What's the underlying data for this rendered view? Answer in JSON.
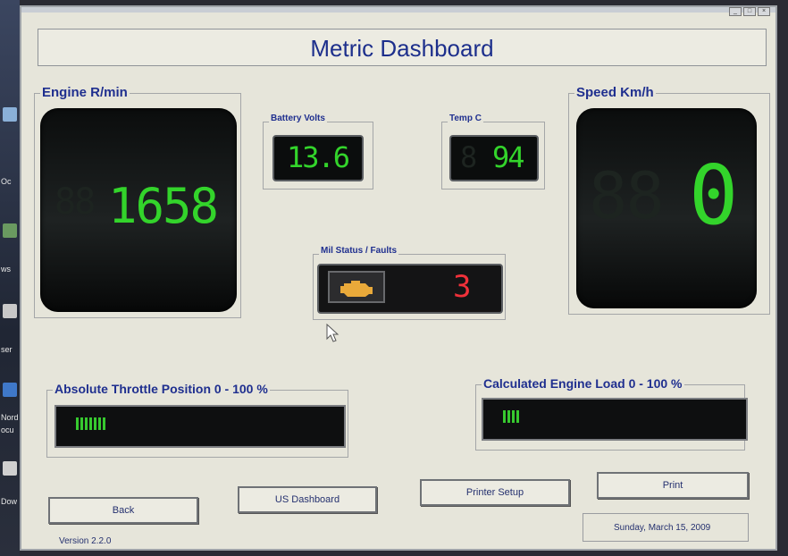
{
  "window": {
    "title": "Metric Dashboard",
    "version": "Version 2.2.0",
    "date": "Sunday, March 15, 2009"
  },
  "engine": {
    "label": "Engine R/min",
    "ghost": "88",
    "value": "1658"
  },
  "speed": {
    "label": "Speed Km/h",
    "ghost": "88",
    "value": "0"
  },
  "battery": {
    "label": "Battery Volts",
    "value": "13.6"
  },
  "temp": {
    "label": "Temp C",
    "ghost": "8",
    "value": "94"
  },
  "mil": {
    "label": "Mil Status / Faults",
    "faults": "3"
  },
  "throttle": {
    "label": "Absolute Throttle Position 0 - 100 %",
    "percent": 12
  },
  "load": {
    "label": "Calculated Engine Load 0 - 100 %",
    "percent": 7
  },
  "buttons": {
    "back": "Back",
    "us_dashboard": "US Dashboard",
    "printer_setup": "Printer Setup",
    "print": "Print"
  },
  "desktop": {
    "labels": [
      "Oc",
      "ws",
      "ser",
      "Nord",
      "ocu",
      "Dow"
    ]
  },
  "colors": {
    "lcd_green": "#33d42b",
    "fault_red": "#f0313a",
    "label_blue": "#1f2f8f"
  }
}
